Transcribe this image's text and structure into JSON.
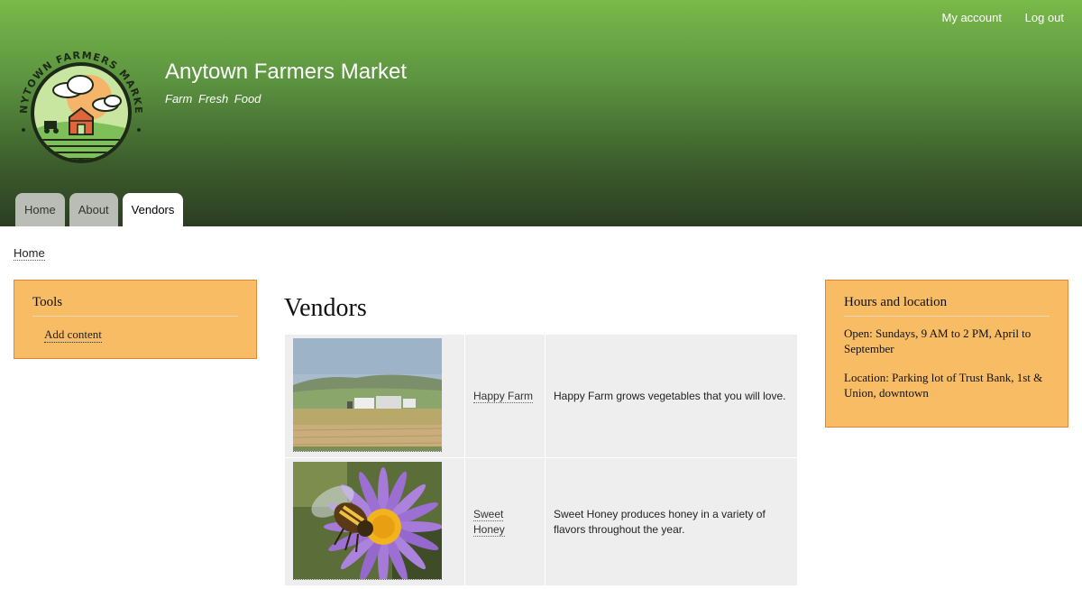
{
  "site": {
    "name": "Anytown Farmers Market",
    "slogan": "Farm Fresh Food",
    "logo_text": "ANYTOWN FARMERS MARKET · FARM FRESH FOOD"
  },
  "secondary_menu": {
    "my_account": "My account",
    "log_out": "Log out"
  },
  "tabs": [
    {
      "label": "Home"
    },
    {
      "label": "About"
    },
    {
      "label": "Vendors"
    }
  ],
  "breadcrumb": {
    "home": "Home"
  },
  "sidebar_first": {
    "title": "Tools",
    "link": "Add content"
  },
  "sidebar_second": {
    "title": "Hours and location",
    "open": "Open: Sundays, 9 AM to 2 PM, April to September",
    "location": "Location: Parking lot of Trust Bank, 1st & Union, downtown"
  },
  "main": {
    "title": "Vendors",
    "vendors": [
      {
        "name": "Happy Farm",
        "description": "Happy Farm grows vegetables that you will love."
      },
      {
        "name": "Sweet Honey",
        "description": "Sweet Honey produces honey in a variety of flavors throughout the year."
      }
    ]
  },
  "colors": {
    "header_top": "#7ab94a",
    "header_bottom": "#2c3d22",
    "block_bg": "#f8bc65",
    "block_border": "#e0873b"
  }
}
